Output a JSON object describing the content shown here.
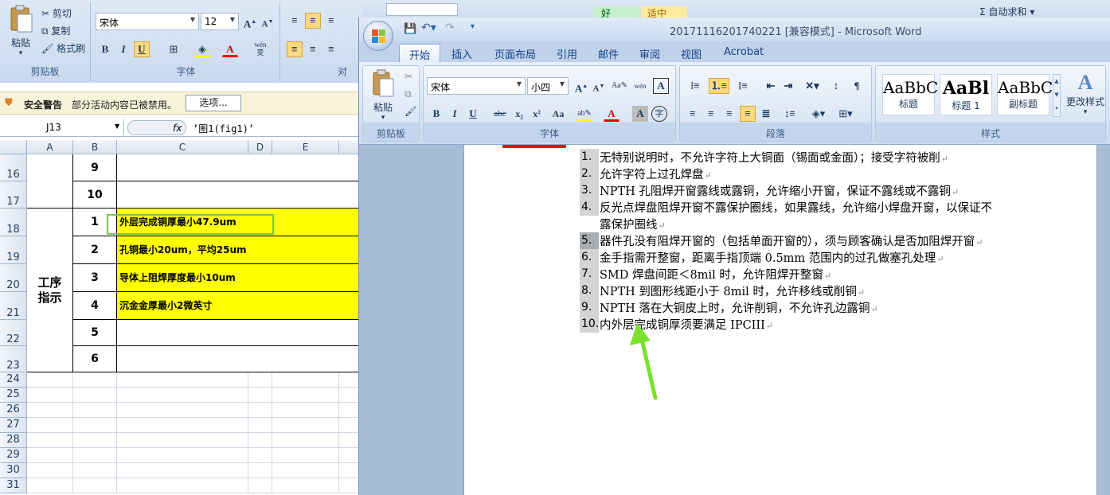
{
  "excel": {
    "clipboard": {
      "paste": "粘贴",
      "cut": "剪切",
      "copy": "复制",
      "format_painter": "格式刷",
      "group": "剪贴板"
    },
    "font": {
      "name": "宋体",
      "size": "12",
      "group": "字体",
      "bold": "B",
      "italic": "I",
      "underline": "U",
      "font_color": "A",
      "wen": "wén\n变"
    },
    "align_group": "对",
    "security": {
      "title": "安全警告",
      "message": "部分活动内容已被禁用。",
      "options": "选项..."
    },
    "name_box": "J13",
    "fx": "fx",
    "formula": "’图1(fig1)’",
    "columns": [
      "A",
      "B",
      "C",
      "D",
      "E"
    ],
    "rows": [
      {
        "num": "16",
        "b": "9",
        "c": ""
      },
      {
        "num": "17",
        "b": "10",
        "c": ""
      },
      {
        "num": "18",
        "b": "1",
        "c": "外层完成铜厚最小47.9um"
      },
      {
        "num": "19",
        "b": "2",
        "c": "孔铜最小20um，平均25um"
      },
      {
        "num": "20",
        "b": "3",
        "c": "导体上阻焊厚度最小10um"
      },
      {
        "num": "21",
        "b": "4",
        "c": "沉金金厚最小2微英寸"
      },
      {
        "num": "22",
        "b": "5",
        "c": ""
      },
      {
        "num": "23",
        "b": "6",
        "c": ""
      }
    ],
    "merged_a": "工序\n指示",
    "empty_rows": [
      "24",
      "25",
      "26",
      "27",
      "28",
      "29",
      "30",
      "31"
    ],
    "top_right": {
      "style_good": "好",
      "style_neutral": "适中",
      "autosum": "Σ 自动求和 ▾"
    }
  },
  "word": {
    "title": "20171116201740221 [兼容模式] - Microsoft Word",
    "tabs": [
      "开始",
      "插入",
      "页面布局",
      "引用",
      "邮件",
      "审阅",
      "视图",
      "Acrobat"
    ],
    "active_tab": "开始",
    "clipboard": {
      "paste": "粘贴",
      "group": "剪贴板"
    },
    "font": {
      "name": "宋体",
      "size": "小四",
      "group": "字体",
      "bold": "B",
      "italic": "I",
      "underline": "U",
      "strike": "abc",
      "sub": "x₂",
      "sup": "x²",
      "case": "Aa",
      "font_color": "A"
    },
    "paragraph_group": "段落",
    "styles": [
      {
        "preview": "AaBbC",
        "name": "标题"
      },
      {
        "preview": "AaBl",
        "name": "标题 1"
      },
      {
        "preview": "AaBbC",
        "name": "副标题"
      }
    ],
    "change_styles": "更改样式",
    "styles_group": "样式",
    "list": [
      {
        "n": "1.",
        "t": "无特别说明时，不允许字符上大铜面（锡面或金面）；接受字符被削"
      },
      {
        "n": "2.",
        "t": "允许字符上过孔焊盘"
      },
      {
        "n": "3.",
        "t": "NPTH 孔阻焊开窗露线或露铜，允许缩小开窗，保证不露线或不露铜"
      },
      {
        "n": "4.",
        "t": "反光点焊盘阻焊开窗不露保护圈线，如果露线，允许缩小焊盘开窗，以保证不",
        "t2": "露保护圈线"
      },
      {
        "n": "5.",
        "t": "器件孔没有阻焊开窗的（包括单面开窗的），须与顾客确认是否加阻焊开窗"
      },
      {
        "n": "6.",
        "t": "金手指需开整窗，距离手指顶端 0.5mm 范围内的过孔做塞孔处理"
      },
      {
        "n": "7.",
        "t": "SMD 焊盘间距＜8mil 时，允许阻焊开整窗"
      },
      {
        "n": "8.",
        "t": "NPTH 到图形线距小于 8mil 时，允许移线或削铜"
      },
      {
        "n": "9.",
        "t": "NPTH 落在大铜皮上时，允许削铜，不允许孔边露铜"
      },
      {
        "n": "10.",
        "t": "内外层完成铜厚须要满足 IPCIII"
      }
    ]
  },
  "colors": {
    "yellow": "#ffff00",
    "arrow": "#7be12c",
    "accent": "#15428b"
  }
}
